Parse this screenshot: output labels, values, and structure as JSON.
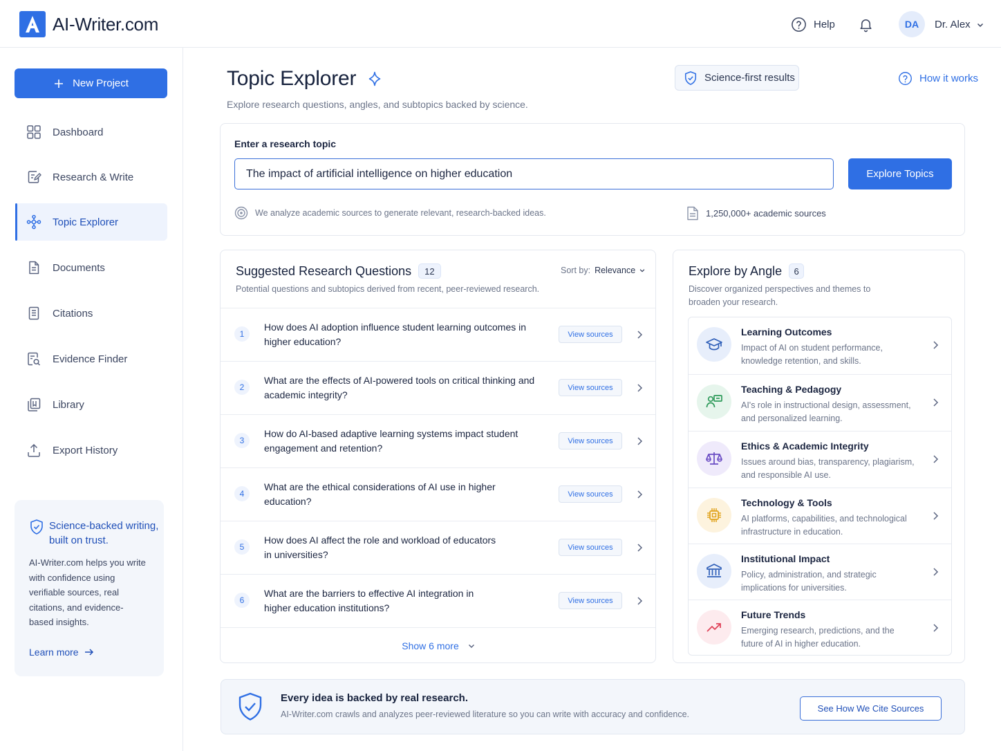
{
  "app": {
    "logo_letter": "A",
    "logo_text": "AI-Writer.com"
  },
  "header": {
    "help_label": "Help",
    "avatar_initials": "DA",
    "user_name": "Dr. Alex"
  },
  "sidebar": {
    "new_project_label": "New Project",
    "items": [
      {
        "label": "Dashboard",
        "icon": "grid-icon"
      },
      {
        "label": "Research & Write",
        "icon": "edit-document-icon"
      },
      {
        "label": "Topic Explorer",
        "icon": "network-icon",
        "active": true
      },
      {
        "label": "Documents",
        "icon": "document-icon"
      },
      {
        "label": "Citations",
        "icon": "list-document-icon"
      },
      {
        "label": "Evidence Finder",
        "icon": "search-document-icon"
      },
      {
        "label": "Library",
        "icon": "library-icon"
      },
      {
        "label": "Export History",
        "icon": "upload-icon"
      }
    ],
    "promo": {
      "title": "Science-backed writing, built on trust.",
      "body": "AI-Writer.com helps you write with confidence using verifiable sources, real citations, and evidence-based insights.",
      "link": "Learn more"
    }
  },
  "page": {
    "title": "Topic Explorer",
    "subtitle": "Explore research questions, angles, and subtopics backed by science.",
    "science_pill": "Science-first results",
    "how_it_works": "How it works"
  },
  "topic": {
    "label": "Enter a research topic",
    "value": "The impact of artificial intelligence on higher education",
    "button": "Explore Topics",
    "analyze_note": "We analyze academic sources to generate relevant, research-backed ideas.",
    "sources_count": "1,250,000+ academic sources"
  },
  "questions": {
    "title": "Suggested Research Questions",
    "count": "12",
    "subtitle": "Potential questions and subtopics derived from recent, peer-reviewed research.",
    "sort_label": "Sort by:",
    "sort_value": "Relevance",
    "view_label": "View sources",
    "show_more": "Show 6 more",
    "items": [
      {
        "num": "1",
        "text": "How does AI adoption influence student learning outcomes in higher education?"
      },
      {
        "num": "2",
        "text": "What are the effects of AI-powered tools on critical thinking and academic integrity?"
      },
      {
        "num": "3",
        "text": "How do AI-based adaptive learning systems impact student engagement and retention?"
      },
      {
        "num": "4",
        "text": "What are the ethical considerations of AI use in higher education?"
      },
      {
        "num": "5",
        "text": "How does AI affect the role and workload of educators in universities?"
      },
      {
        "num": "6",
        "text": "What are the barriers to effective AI integration in higher education institutions?"
      }
    ]
  },
  "angles": {
    "title": "Explore by Angle",
    "count": "6",
    "subtitle": "Discover organized perspectives and themes to broaden your research.",
    "items": [
      {
        "name": "Learning Outcomes",
        "desc": "Impact of AI on student performance, knowledge retention, and skills.",
        "icon": "graduation-cap-icon",
        "color": "#2f5fb8",
        "bg": "#e7eefb"
      },
      {
        "name": "Teaching & Pedagogy",
        "desc": "AI's role in instructional design, assessment, and personalized learning.",
        "icon": "teacher-icon",
        "color": "#2e9a5a",
        "bg": "#e6f5ec"
      },
      {
        "name": "Ethics & Academic Integrity",
        "desc": "Issues around bias, transparency, plagiarism, and responsible AI use.",
        "icon": "scales-icon",
        "color": "#6a4cc4",
        "bg": "#efeafb"
      },
      {
        "name": "Technology & Tools",
        "desc": "AI platforms, capabilities, and technological infrastructure in education.",
        "icon": "chip-icon",
        "color": "#e0a21a",
        "bg": "#fdf3de"
      },
      {
        "name": "Institutional Impact",
        "desc": "Policy, administration, and strategic implications for universities.",
        "icon": "institution-icon",
        "color": "#2f5fb8",
        "bg": "#e7eefb"
      },
      {
        "name": "Future Trends",
        "desc": "Emerging research, predictions, and the future of AI in higher education.",
        "icon": "trend-up-icon",
        "color": "#e0445a",
        "bg": "#fdebee"
      }
    ]
  },
  "banner": {
    "title": "Every idea is backed by real research.",
    "body": "AI-Writer.com crawls and analyzes peer-reviewed literature so you can write with accuracy and confidence.",
    "button": "See How We Cite Sources"
  }
}
